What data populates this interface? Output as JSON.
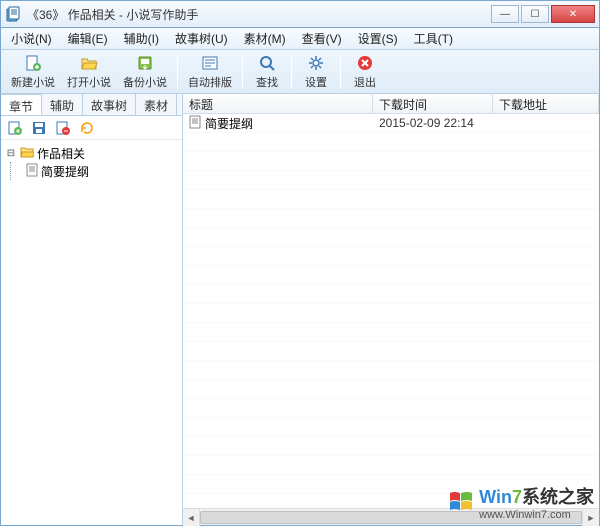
{
  "window": {
    "title": "《36》 作品相关 - 小说写作助手"
  },
  "menu": {
    "items": [
      "小说(N)",
      "编辑(E)",
      "辅助(I)",
      "故事树(U)",
      "素材(M)",
      "查看(V)",
      "设置(S)",
      "工具(T)"
    ]
  },
  "toolbar": {
    "new_novel": "新建小说",
    "open_novel": "打开小说",
    "backup_novel": "备份小说",
    "auto_layout": "自动排版",
    "find": "查找",
    "settings": "设置",
    "exit": "退出"
  },
  "left": {
    "tabs": [
      "章节",
      "辅助",
      "故事树",
      "素材"
    ],
    "active_tab_index": 0,
    "root_label": "作品相关",
    "child_label": "简要提纲"
  },
  "list": {
    "headers": {
      "title": "标题",
      "time": "下载时间",
      "url": "下载地址"
    },
    "rows": [
      {
        "title": "简要提纲",
        "time": "2015-02-09 22:14",
        "url": ""
      }
    ]
  },
  "watermark": {
    "brand_prefix": "Win",
    "brand_digit": "7",
    "brand_suffix": "系统之家",
    "domain": "www.Winwin7.com"
  }
}
